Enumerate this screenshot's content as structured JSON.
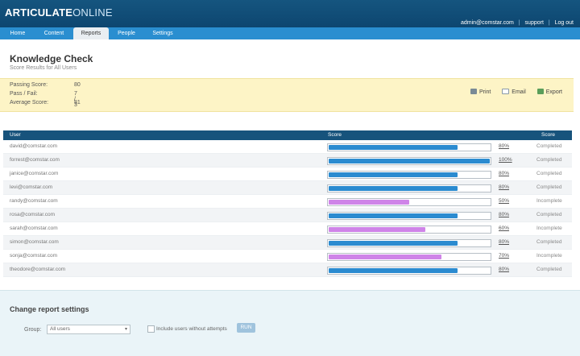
{
  "app": {
    "brand_bold": "ARTICULATE",
    "brand_light": "ONLINE",
    "user_email": "admin@comstar.com",
    "support": "support",
    "logout": "Log out"
  },
  "nav": {
    "tabs": [
      {
        "label": "Home"
      },
      {
        "label": "Content"
      },
      {
        "label": "Reports",
        "active": true
      },
      {
        "label": "People"
      },
      {
        "label": "Settings"
      }
    ]
  },
  "page": {
    "title": "Knowledge Check",
    "subtitle": "Score Results for All Users"
  },
  "summary": {
    "passing_label": "Passing Score:",
    "passing_value": "80",
    "passfail_label": "Pass / Fail:",
    "passfail_value": "7 / 3",
    "average_label": "Average Score:",
    "average_value": "81"
  },
  "actions": {
    "print": "Print",
    "email": "Email",
    "export": "Export"
  },
  "table": {
    "headers": {
      "user": "User",
      "score": "Score",
      "status": "Score"
    },
    "rows": [
      {
        "email": "david@comstar.com",
        "score": 80,
        "pct": "80%",
        "status": "Completed"
      },
      {
        "email": "forrest@comstar.com",
        "score": 100,
        "pct": "100%",
        "status": "Completed"
      },
      {
        "email": "janice@comstar.com",
        "score": 80,
        "pct": "80%",
        "status": "Completed"
      },
      {
        "email": "levi@comstar.com",
        "score": 80,
        "pct": "80%",
        "status": "Completed"
      },
      {
        "email": "randy@comstar.com",
        "score": 50,
        "pct": "50%",
        "status": "Incomplete"
      },
      {
        "email": "rosa@comstar.com",
        "score": 80,
        "pct": "80%",
        "status": "Completed"
      },
      {
        "email": "sarah@comstar.com",
        "score": 60,
        "pct": "60%",
        "status": "Incomplete"
      },
      {
        "email": "simon@comstar.com",
        "score": 80,
        "pct": "80%",
        "status": "Completed"
      },
      {
        "email": "sonja@comstar.com",
        "score": 70,
        "pct": "70%",
        "status": "Incomplete"
      },
      {
        "email": "theodore@comstar.com",
        "score": 80,
        "pct": "80%",
        "status": "Completed"
      }
    ]
  },
  "colors": {
    "pass_bar": "#2b8bd0",
    "fail_bar": "#cf84e8"
  },
  "settings": {
    "title": "Change report settings",
    "group_label": "Group:",
    "group_value": "All users",
    "checkbox_label": "Include users without attempts",
    "run_label": "RUN"
  }
}
